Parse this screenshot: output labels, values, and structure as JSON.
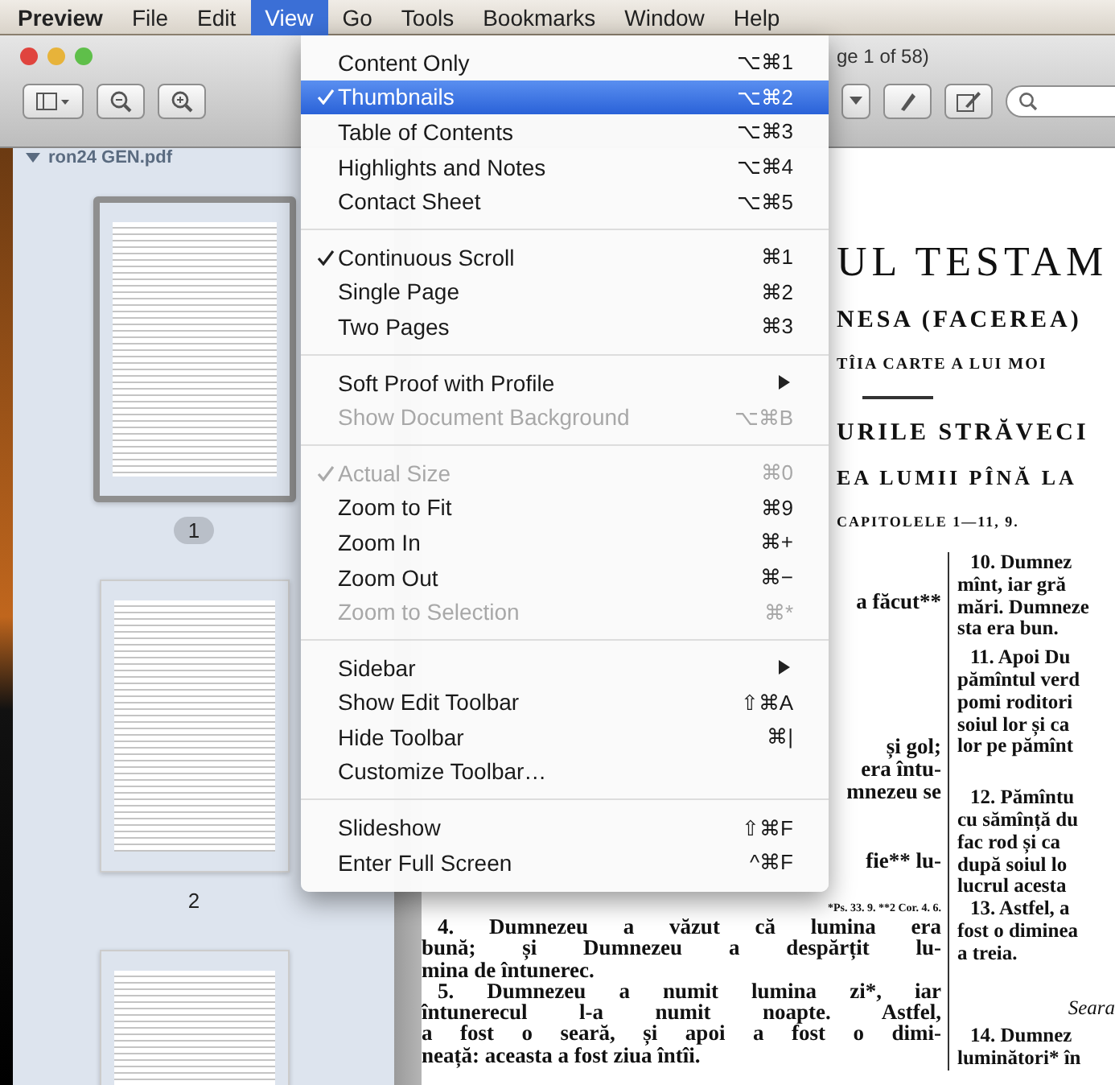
{
  "menu_bar": {
    "items": [
      {
        "label": "Preview",
        "selected": false,
        "app": true
      },
      {
        "label": "File",
        "selected": false,
        "app": false
      },
      {
        "label": "Edit",
        "selected": false,
        "app": false
      },
      {
        "label": "View",
        "selected": true,
        "app": false
      },
      {
        "label": "Go",
        "selected": false,
        "app": false
      },
      {
        "label": "Tools",
        "selected": false,
        "app": false
      },
      {
        "label": "Bookmarks",
        "selected": false,
        "app": false
      },
      {
        "label": "Window",
        "selected": false,
        "app": false
      },
      {
        "label": "Help",
        "selected": false,
        "app": false
      }
    ]
  },
  "window": {
    "title": "ge 1 of 58)"
  },
  "sidebar": {
    "file": "ron24 GEN.pdf",
    "expanded": true,
    "thumbnails": [
      {
        "label": "1",
        "selected": true
      },
      {
        "label": "2",
        "selected": false
      },
      {
        "selected": false
      }
    ]
  },
  "view_menu": {
    "items": [
      {
        "kind": "item",
        "label": "Content Only",
        "shortcut": "⌥⌘1",
        "checked": false,
        "disabled": false,
        "selected": false,
        "submenu": false
      },
      {
        "kind": "item",
        "label": "Thumbnails",
        "shortcut": "⌥⌘2",
        "checked": true,
        "disabled": false,
        "selected": true,
        "submenu": false
      },
      {
        "kind": "item",
        "label": "Table of Contents",
        "shortcut": "⌥⌘3",
        "checked": false,
        "disabled": false,
        "selected": false,
        "submenu": false
      },
      {
        "kind": "item",
        "label": "Highlights and Notes",
        "shortcut": "⌥⌘4",
        "checked": false,
        "disabled": false,
        "selected": false,
        "submenu": false
      },
      {
        "kind": "item",
        "label": "Contact Sheet",
        "shortcut": "⌥⌘5",
        "checked": false,
        "disabled": false,
        "selected": false,
        "submenu": false
      },
      {
        "kind": "separator"
      },
      {
        "kind": "item",
        "label": "Continuous Scroll",
        "shortcut": "⌘1",
        "checked": true,
        "disabled": false,
        "selected": false,
        "submenu": false
      },
      {
        "kind": "item",
        "label": "Single Page",
        "shortcut": "⌘2",
        "checked": false,
        "disabled": false,
        "selected": false,
        "submenu": false
      },
      {
        "kind": "item",
        "label": "Two Pages",
        "shortcut": "⌘3",
        "checked": false,
        "disabled": false,
        "selected": false,
        "submenu": false
      },
      {
        "kind": "separator"
      },
      {
        "kind": "item",
        "label": "Soft Proof with Profile",
        "checked": false,
        "disabled": false,
        "selected": false,
        "submenu": true
      },
      {
        "kind": "item",
        "label": "Show Document Background",
        "shortcut": "⌥⌘B",
        "checked": false,
        "disabled": true,
        "selected": false,
        "submenu": false
      },
      {
        "kind": "separator"
      },
      {
        "kind": "item",
        "label": "Actual Size",
        "shortcut": "⌘0",
        "checked": true,
        "disabled": true,
        "selected": false,
        "submenu": false
      },
      {
        "kind": "item",
        "label": "Zoom to Fit",
        "shortcut": "⌘9",
        "checked": false,
        "disabled": false,
        "selected": false,
        "submenu": false
      },
      {
        "kind": "item",
        "label": "Zoom In",
        "shortcut": "⌘+",
        "checked": false,
        "disabled": false,
        "selected": false,
        "submenu": false
      },
      {
        "kind": "item",
        "label": "Zoom Out",
        "shortcut": "⌘−",
        "checked": false,
        "disabled": false,
        "selected": false,
        "submenu": false
      },
      {
        "kind": "item",
        "label": "Zoom to Selection",
        "shortcut": "⌘*",
        "checked": false,
        "disabled": true,
        "selected": false,
        "submenu": false
      },
      {
        "kind": "separator"
      },
      {
        "kind": "item",
        "label": "Sidebar",
        "checked": false,
        "disabled": false,
        "selected": false,
        "submenu": true
      },
      {
        "kind": "item",
        "label": "Show Edit Toolbar",
        "shortcut": "⇧⌘A",
        "checked": false,
        "disabled": false,
        "selected": false,
        "submenu": false
      },
      {
        "kind": "item",
        "label": "Hide Toolbar",
        "shortcut": "⌘|",
        "checked": false,
        "disabled": false,
        "selected": false,
        "submenu": false
      },
      {
        "kind": "item",
        "label": "Customize Toolbar…",
        "checked": false,
        "disabled": false,
        "selected": false,
        "submenu": false
      },
      {
        "kind": "separator"
      },
      {
        "kind": "item",
        "label": "Slideshow",
        "shortcut": "⇧⌘F",
        "checked": false,
        "disabled": false,
        "selected": false,
        "submenu": false
      },
      {
        "kind": "item",
        "label": "Enter Full Screen",
        "shortcut": "^⌘F",
        "checked": false,
        "disabled": false,
        "selected": false,
        "submenu": false
      }
    ]
  },
  "document": {
    "title": "UL TESTAM",
    "book": "NESA (FACEREA)",
    "subtitle": "TÎIA CARTE A LUI MOI",
    "section": "URILE STRĂVECI",
    "section_2": "EA LUMII PÎNĂ LA",
    "chapters": "CAPITOLELE 1—11, 9.",
    "left_fragments": [
      "a făcut**",
      "și gol;",
      "era întu-",
      "mnezeu se",
      "fie** lu-"
    ],
    "footnote": "*Ps. 33. 9. **2 Cor. 4. 6.",
    "left_paragraphs": [
      {
        "lines": [
          "4. Dumnezeu a văzut că lumina era",
          "bună; și Dumnezeu a despărțit lu-",
          "mina de întunerec."
        ]
      },
      {
        "lines": [
          "5. Dumnezeu a numit lumina zi*, iar",
          "întunerecul l-a numit noapte. Astfel,",
          "a fost o seară, și apoi a fost o dimi-",
          "neață: aceasta a fost ziua întîi."
        ]
      }
    ],
    "right_blocks": [
      {
        "kind": "verse",
        "lines": [
          "10. Dumnez",
          "mînt, iar gră",
          "mări. Dumneze",
          "sta era bun."
        ]
      },
      {
        "kind": "verse",
        "lines": [
          "11. Apoi Du",
          "pămîntul verd",
          "pomi roditori",
          "soiul lor și ca",
          "lor pe pămînt"
        ]
      },
      {
        "kind": "verse",
        "lines": [
          "12. Pămîntu",
          "cu sămînță du",
          "fac rod și ca",
          "după soiul lo",
          "lucrul acesta"
        ]
      },
      {
        "kind": "verse",
        "lines": [
          "13. Astfel, a",
          "fost o diminea",
          "a treia."
        ]
      },
      {
        "kind": "heading",
        "lines": [
          "Seara"
        ]
      },
      {
        "kind": "verse",
        "lines": [
          "14. Dumnez",
          "luminători* în"
        ]
      }
    ]
  }
}
